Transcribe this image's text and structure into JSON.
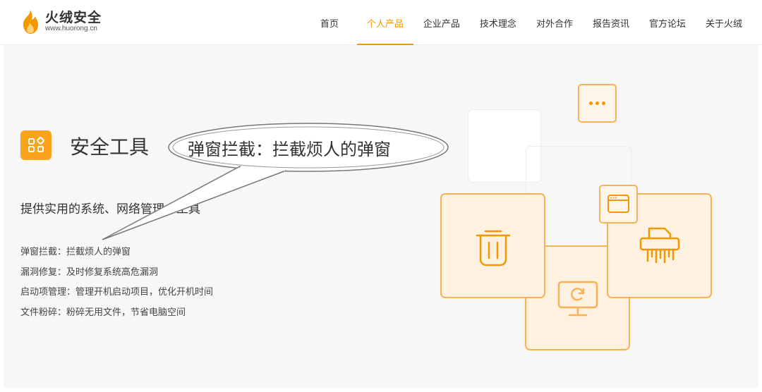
{
  "header": {
    "logo_title": "火绒安全",
    "logo_url": "www.huorong.cn",
    "nav": [
      {
        "label": "首页",
        "active": false
      },
      {
        "label": "个人产品",
        "active": true
      },
      {
        "label": "企业产品",
        "active": false
      },
      {
        "label": "技术理念",
        "active": false
      },
      {
        "label": "对外合作",
        "active": false
      },
      {
        "label": "报告资讯",
        "active": false
      },
      {
        "label": "官方论坛",
        "active": false
      },
      {
        "label": "关于火绒",
        "active": false
      }
    ]
  },
  "main": {
    "title": "安全工具",
    "description": "提供实用的系统、网络管理小工具",
    "features": [
      "弹窗拦截：拦截烦人的弹窗",
      "漏洞修复：及时修复系统高危漏洞",
      "启动项管理：管理开机启动项目，优化开机时间",
      "文件粉碎：粉碎无用文件，节省电脑空间"
    ]
  },
  "callout": {
    "text": "弹窗拦截：拦截烦人的弹窗"
  },
  "colors": {
    "accent": "#f39800",
    "icon_bg": "#f9a41a",
    "card_border": "#f7b257",
    "card_fill": "#fff1e0",
    "panel_bg": "#f7f7f7"
  },
  "icons": [
    "logo-flame-icon",
    "tools-grid-icon",
    "trash-icon",
    "monitor-refresh-icon",
    "shredder-icon",
    "more-dots-icon",
    "browser-window-icon"
  ]
}
